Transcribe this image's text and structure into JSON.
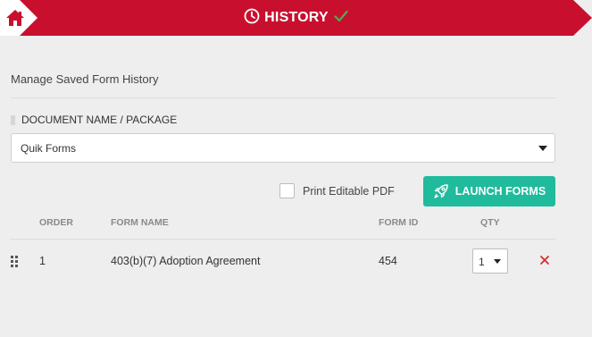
{
  "header": {
    "title": "HISTORY",
    "home_icon": "home-icon",
    "clock_icon": "clock-icon",
    "check_icon": "checkmark-icon",
    "colors": {
      "band": "#c8102e",
      "check": "#4caf50"
    }
  },
  "main": {
    "subtitle": "Manage Saved Form History",
    "document_field": {
      "label": "DOCUMENT NAME / PACKAGE",
      "selected": "Quik Forms"
    },
    "print_editable_label": "Print Editable PDF",
    "print_editable_checked": false,
    "launch_button": {
      "label": "LAUNCH FORMS",
      "icon": "rocket-icon",
      "color": "#1fbb9c"
    }
  },
  "table": {
    "columns": {
      "order": "ORDER",
      "form_name": "FORM NAME",
      "form_id": "FORM ID",
      "qty": "QTY"
    },
    "rows": [
      {
        "order": "1",
        "form_name": "403(b)(7) Adoption Agreement",
        "form_id": "454",
        "qty": "1"
      }
    ],
    "remove_icon": "close-icon",
    "remove_color": "#d32f2f"
  }
}
